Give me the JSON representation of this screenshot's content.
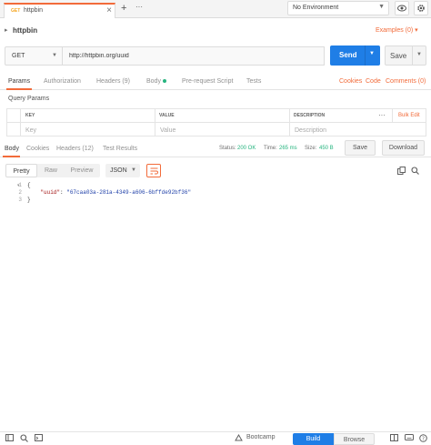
{
  "tabs": [
    {
      "method": "GET",
      "name": "httpbin"
    }
  ],
  "tabbar": {
    "close_glyph": "×",
    "add_glyph": "+",
    "more_glyph": "···"
  },
  "environment": {
    "selected": "No Environment"
  },
  "request": {
    "name": "httpbin",
    "examples_label": "Examples (0)",
    "method": "GET",
    "url": "http://httpbin.org/uuid",
    "send_label": "Send",
    "save_label": "Save"
  },
  "request_tabs": [
    {
      "label": "Params",
      "active": true
    },
    {
      "label": "Authorization"
    },
    {
      "label": "Headers (9)"
    },
    {
      "label": "Body"
    },
    {
      "label": "Pre-request Script"
    },
    {
      "label": "Tests"
    }
  ],
  "request_links": {
    "cookies": "Cookies",
    "code": "Code",
    "comments": "Comments (0)"
  },
  "params": {
    "section_title": "Query Params",
    "columns": [
      "KEY",
      "VALUE",
      "DESCRIPTION"
    ],
    "more_glyph": "···",
    "bulk_edit": "Bulk Edit",
    "placeholders": [
      "Key",
      "Value",
      "Description"
    ]
  },
  "response_tabs": [
    {
      "label": "Body",
      "active": true
    },
    {
      "label": "Cookies"
    },
    {
      "label": "Headers (12)"
    },
    {
      "label": "Test Results"
    }
  ],
  "response_status": {
    "status_label": "Status:",
    "status_value": "200 OK",
    "time_label": "Time:",
    "time_value": "265 ms",
    "size_label": "Size:",
    "size_value": "450 B",
    "save_label": "Save",
    "download_label": "Download"
  },
  "format_bar": {
    "pretty": "Pretty",
    "raw": "Raw",
    "preview": "Preview",
    "format": "JSON"
  },
  "response_body": {
    "line_numbers": [
      "1",
      "2",
      "3"
    ],
    "open_brace": "{",
    "key": "\"uuid\"",
    "value": "\"67caa03a-281a-4349-a606-6bffde92bf36\"",
    "close_brace": "}"
  },
  "footer": {
    "bootcamp": "Bootcamp",
    "build": "Build",
    "browse": "Browse"
  },
  "colors": {
    "accent": "#f26b3a",
    "primary": "#1f7ee6",
    "success": "#26b47f"
  }
}
